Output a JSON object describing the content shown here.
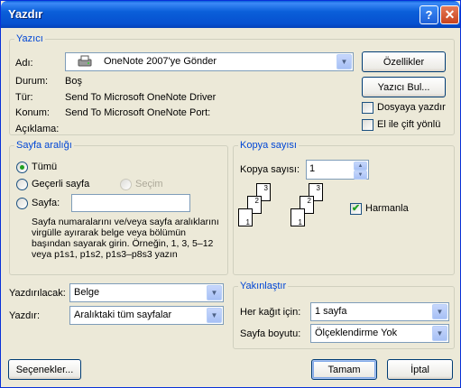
{
  "window": {
    "title": "Yazdır",
    "help_glyph": "?",
    "close_glyph": "✕"
  },
  "printer": {
    "group_label": "Yazıcı",
    "name_label": "Adı:",
    "name_value": "OneNote 2007'ye Gönder",
    "status_label": "Durum:",
    "status_value": "Boş",
    "type_label": "Tür:",
    "type_value": "Send To Microsoft OneNote Driver",
    "location_label": "Konum:",
    "location_value": "Send To Microsoft OneNote Port:",
    "comment_label": "Açıklama:",
    "comment_value": "",
    "properties_button": "Özellikler",
    "find_printer_button": "Yazıcı Bul...",
    "print_to_file_label": "Dosyaya yazdır",
    "print_to_file_checked": false,
    "manual_duplex_label": "El ile çift yönlü",
    "manual_duplex_checked": false
  },
  "page_range": {
    "group_label": "Sayfa aralığı",
    "all_label": "Tümü",
    "current_page_label": "Geçerli sayfa",
    "selection_label": "Seçim",
    "pages_label": "Sayfa:",
    "pages_value": "",
    "selected": "all",
    "help_text": "Sayfa numaralarını ve/veya sayfa aralıklarını virgülle ayırarak belge veya bölümün başından sayarak girin. Örneğin, 1, 3, 5–12 veya p1s1, p1s2, p1s3–p8s3 yazın"
  },
  "copies": {
    "group_label": "Kopya sayısı",
    "count_label": "Kopya sayısı:",
    "count_value": "1",
    "collate_label": "Harmanla",
    "collate_checked": true,
    "page_numbers": [
      "1",
      "2",
      "3"
    ]
  },
  "print_what": {
    "label": "Yazdırılacak:",
    "value": "Belge"
  },
  "print_range": {
    "label": "Yazdır:",
    "value": "Aralıktaki tüm sayfalar"
  },
  "zoom": {
    "group_label": "Yakınlaştır",
    "pages_per_sheet_label": "Her kağıt için:",
    "pages_per_sheet_value": "1 sayfa",
    "scale_label": "Sayfa boyutu:",
    "scale_value": "Ölçeklendirme Yok"
  },
  "footer": {
    "options_button": "Seçenekler...",
    "ok_button": "Tamam",
    "cancel_button": "İptal"
  }
}
